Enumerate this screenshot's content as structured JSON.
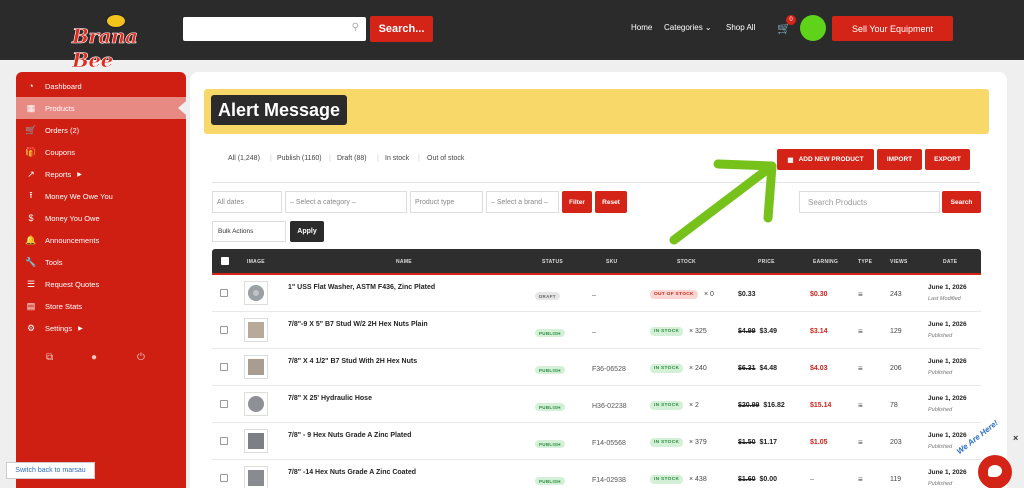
{
  "header": {
    "logo_text": "Brana Bee",
    "search_button": "Search...",
    "nav": [
      "Home",
      "Categories",
      "Shop All"
    ],
    "cart_count": "0",
    "sell_button": "Sell Your Equipment"
  },
  "sidebar": {
    "items": [
      {
        "label": "Dashboard",
        "icon": "dashboard-icon"
      },
      {
        "label": "Products",
        "icon": "briefcase-icon",
        "active": true
      },
      {
        "label": "Orders (2)",
        "icon": "cart-icon"
      },
      {
        "label": "Coupons",
        "icon": "gift-icon"
      },
      {
        "label": "Reports",
        "icon": "chart-icon",
        "submenu": true
      },
      {
        "label": "Money We Owe You",
        "icon": "upload-icon"
      },
      {
        "label": "Money You Owe",
        "icon": "dollar-icon"
      },
      {
        "label": "Announcements",
        "icon": "bell-icon"
      },
      {
        "label": "Tools",
        "icon": "wrench-icon"
      },
      {
        "label": "Request Quotes",
        "icon": "list-icon"
      },
      {
        "label": "Store Stats",
        "icon": "stats-icon"
      },
      {
        "label": "Settings",
        "icon": "gear-icon",
        "submenu": true
      }
    ],
    "switch_back": "Switch back to marsau"
  },
  "alert": {
    "title": "Alert Message"
  },
  "filter_tabs": [
    "All (1,248)",
    "Publish (1160)",
    "Draft (88)",
    "In stock",
    "Out of stock"
  ],
  "actions": {
    "add": "ADD NEW PRODUCT",
    "import": "IMPORT",
    "export": "EXPORT"
  },
  "filters": {
    "dates": "All dates",
    "category": "– Select a category –",
    "product_type": "Product type",
    "brand": "– Select a brand –",
    "filter_btn": "Filter",
    "reset_btn": "Reset",
    "search_placeholder": "Search Products",
    "search_btn": "Search",
    "bulk": "Bulk Actions",
    "apply": "Apply"
  },
  "table": {
    "headers": [
      "IMAGE",
      "NAME",
      "STATUS",
      "SKU",
      "STOCK",
      "PRICE",
      "EARNING",
      "TYPE",
      "VIEWS",
      "DATE"
    ],
    "rows": [
      {
        "name": "1\" USS Flat Washer, ASTM F436, Zinc Plated",
        "status": "DRAFT",
        "sku": "–",
        "stock": "OUT OF STOCK",
        "qty": "× 0",
        "old_price": "",
        "price": "$0.33",
        "earning": "$0.30",
        "views": "243",
        "date": "June 1, 2026",
        "date_sub": "Last Modified"
      },
      {
        "name": "7/8\"-9 X 5\" B7 Stud W/2 2H Hex Nuts Plain",
        "status": "PUBLISH",
        "sku": "–",
        "stock": "IN STOCK",
        "qty": "× 325",
        "old_price": "$4.99",
        "price": "$3.49",
        "earning": "$3.14",
        "views": "129",
        "date": "June 1, 2026",
        "date_sub": "Published"
      },
      {
        "name": "7/8\" X 4 1/2\" B7 Stud With 2H Hex Nuts",
        "status": "PUBLISH",
        "sku": "F36-06528",
        "stock": "IN STOCK",
        "qty": "× 240",
        "old_price": "$6.31",
        "price": "$4.48",
        "earning": "$4.03",
        "views": "206",
        "date": "June 1, 2026",
        "date_sub": "Published"
      },
      {
        "name": "7/8\" X 25' Hydraulic Hose",
        "status": "PUBLISH",
        "sku": "H36-02238",
        "stock": "IN STOCK",
        "qty": "× 2",
        "old_price": "$20.99",
        "price": "$16.82",
        "earning": "$15.14",
        "views": "78",
        "date": "June 1, 2026",
        "date_sub": "Published"
      },
      {
        "name": "7/8\" - 9 Hex Nuts Grade A Zinc Plated",
        "status": "PUBLISH",
        "sku": "F14-05568",
        "stock": "IN STOCK",
        "qty": "× 379",
        "old_price": "$1.50",
        "price": "$1.17",
        "earning": "$1.05",
        "views": "203",
        "date": "June 1, 2026",
        "date_sub": "Published"
      },
      {
        "name": "7/8\" -14 Hex Nuts Grade A Zinc Coated",
        "status": "PUBLISH",
        "sku": "F14-02938",
        "stock": "IN STOCK",
        "qty": "× 438",
        "old_price": "$1.60",
        "price": "$0.00",
        "earning": "–",
        "views": "119",
        "date": "June 1, 2026",
        "date_sub": "Published"
      }
    ]
  },
  "chat": {
    "label": "We Are Here!"
  },
  "colors": {
    "accent": "#d42418",
    "alert": "#f8d868",
    "arrow": "#76c11a"
  }
}
